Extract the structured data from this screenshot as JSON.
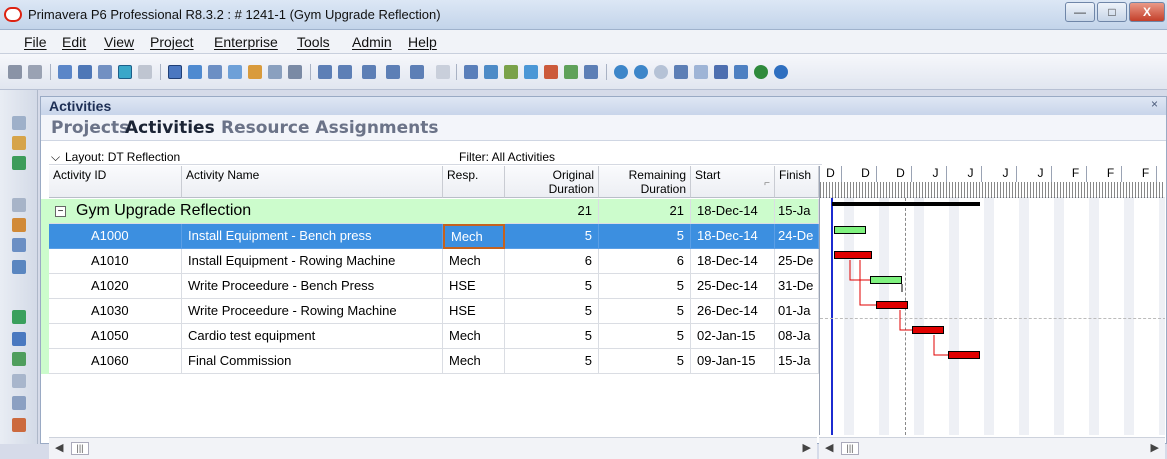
{
  "window": {
    "title": "Primavera P6 Professional R8.3.2 : # 1241-1 (Gym Upgrade Reflection)",
    "minimize": "—",
    "maximize": "□",
    "close": "X"
  },
  "menu": [
    "File",
    "Edit",
    "View",
    "Project",
    "Enterprise",
    "Tools",
    "Admin",
    "Help"
  ],
  "panel": {
    "title": "Activities",
    "close": "×",
    "tabs": [
      "Projects",
      "Activities",
      "Resource Assignments"
    ],
    "active_tab": "Activities",
    "layout_label": "Layout: DT  Reflection",
    "filter_label": "Filter: All Activities"
  },
  "columns": {
    "activity_id": "Activity ID",
    "activity_name": "Activity Name",
    "resp": "Resp.",
    "original_duration_1": "Original",
    "original_duration_2": "Duration",
    "remaining_duration_1": "Remaining",
    "remaining_duration_2": "Duration",
    "start": "Start",
    "finish": "Finish"
  },
  "wbs": {
    "name": "Gym Upgrade Reflection",
    "original": "21",
    "remaining": "21",
    "start": "18-Dec-14",
    "finish": "15-Ja"
  },
  "rows": [
    {
      "id": "A1000",
      "name": "Install Equipment - Bench press",
      "resp": "Mech",
      "orig": "5",
      "rem": "5",
      "start": "18-Dec-14",
      "finish": "24-De",
      "selected": true
    },
    {
      "id": "A1010",
      "name": "Install Equipment - Rowing Machine",
      "resp": "Mech",
      "orig": "6",
      "rem": "6",
      "start": "18-Dec-14",
      "finish": "25-De",
      "selected": false
    },
    {
      "id": "A1020",
      "name": "Write Proceedure - Bench Press",
      "resp": "HSE",
      "orig": "5",
      "rem": "5",
      "start": "25-Dec-14",
      "finish": "31-De",
      "selected": false
    },
    {
      "id": "A1030",
      "name": "Write Proceedure - Rowing Machine",
      "resp": "HSE",
      "orig": "5",
      "rem": "5",
      "start": "26-Dec-14",
      "finish": "01-Ja",
      "selected": false
    },
    {
      "id": "A1050",
      "name": "Cardio test equipment",
      "resp": "Mech",
      "orig": "5",
      "rem": "5",
      "start": "02-Jan-15",
      "finish": "08-Ja",
      "selected": false
    },
    {
      "id": "A1060",
      "name": "Final Commission",
      "resp": "Mech",
      "orig": "5",
      "rem": "5",
      "start": "09-Jan-15",
      "finish": "15-Ja",
      "selected": false
    }
  ],
  "gantt": {
    "months": [
      "D",
      "D",
      "D",
      "J",
      "J",
      "J",
      "J",
      "F",
      "F",
      "F"
    ]
  },
  "colors": {
    "selection": "#3c8fe0",
    "wbs_band": "#ccfccc",
    "critical_bar": "#e00000",
    "noncritical_bar": "#7ff27f"
  }
}
